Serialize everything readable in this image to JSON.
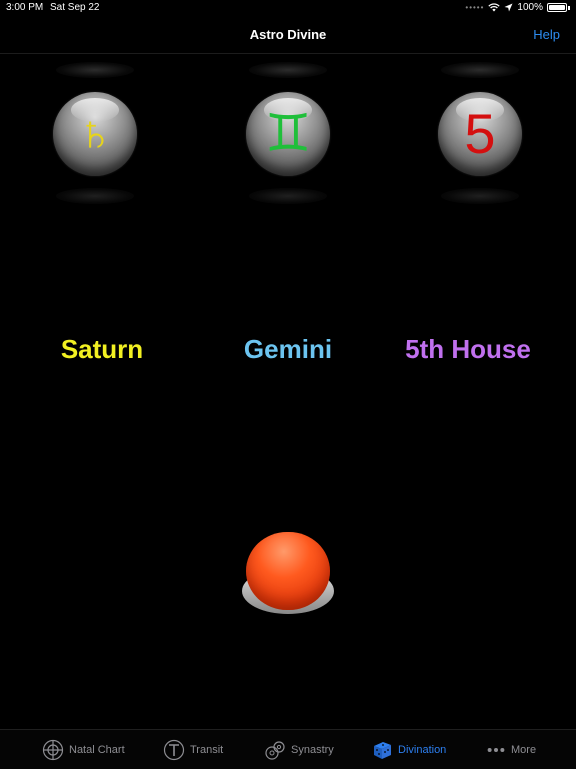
{
  "status_bar": {
    "time": "3:00 PM",
    "date": "Sat Sep 22",
    "battery": "100%"
  },
  "nav": {
    "title": "Astro Divine",
    "help": "Help"
  },
  "orbs": [
    {
      "symbol": "♄",
      "color": "#e6d31a"
    },
    {
      "symbol": "♊",
      "color": "#1fbf3a"
    },
    {
      "symbol": "5",
      "color": "#d40f0f"
    }
  ],
  "results": [
    {
      "label": "Saturn",
      "color": "#f2f022"
    },
    {
      "label": "Gemini",
      "color": "#6cc4f0"
    },
    {
      "label": "5th House",
      "color": "#c070ee"
    }
  ],
  "tabs": [
    {
      "label": "Natal Chart",
      "icon": "natal-chart-icon"
    },
    {
      "label": "Transit",
      "icon": "transit-icon"
    },
    {
      "label": "Synastry",
      "icon": "synastry-icon"
    },
    {
      "label": "Divination",
      "icon": "dice-icon",
      "active": true
    },
    {
      "label": "More",
      "icon": "more-dots-icon"
    }
  ],
  "colors": {
    "accent": "#2d7ff0",
    "inactive": "#8e8e93"
  }
}
